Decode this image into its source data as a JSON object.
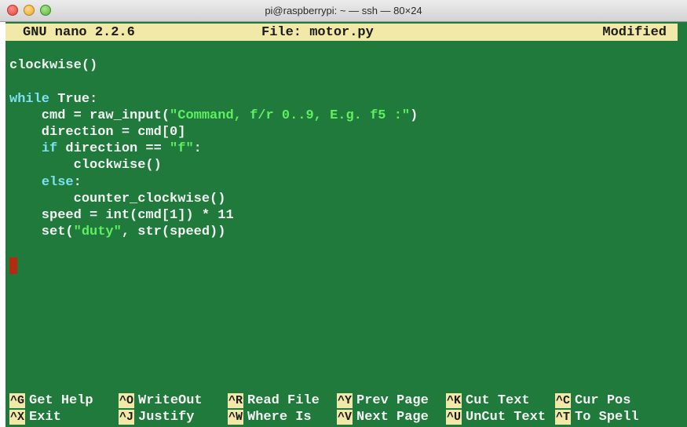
{
  "window": {
    "title": "pi@raspberrypi: ~ — ssh — 80×24"
  },
  "nano": {
    "version": "GNU nano 2.2.6",
    "file": "File: motor.py",
    "state": "Modified"
  },
  "code": {
    "l1": "clockwise()",
    "l3_kw": "while",
    "l3_rest": " True:",
    "l4_a": "    cmd = raw_input(",
    "l4_str": "\"Command, f/r 0..9, E.g. f5 :\"",
    "l4_b": ")",
    "l5": "    direction = cmd[0]",
    "l6_kw": "if",
    "l6_a": " direction == ",
    "l6_str": "\"f\"",
    "l6_b": ":",
    "l7": "        clockwise()",
    "l8_kw": "else",
    "l8_b": ":",
    "l9": "        counter_clockwise()",
    "l10": "    speed = int(cmd[1]) * 11",
    "l11_a": "    set(",
    "l11_str": "\"duty\"",
    "l11_b": ", str(speed))"
  },
  "shortcuts": [
    {
      "key": "^G",
      "label": "Get Help"
    },
    {
      "key": "^O",
      "label": "WriteOut"
    },
    {
      "key": "^R",
      "label": "Read File"
    },
    {
      "key": "^Y",
      "label": "Prev Page"
    },
    {
      "key": "^K",
      "label": "Cut Text"
    },
    {
      "key": "^C",
      "label": "Cur Pos"
    },
    {
      "key": "^X",
      "label": "Exit"
    },
    {
      "key": "^J",
      "label": "Justify"
    },
    {
      "key": "^W",
      "label": "Where Is"
    },
    {
      "key": "^V",
      "label": "Next Page"
    },
    {
      "key": "^U",
      "label": "UnCut Text"
    },
    {
      "key": "^T",
      "label": "To Spell"
    }
  ],
  "colors": {
    "terminal_bg": "#1f7a3c",
    "header_bg": "#f2e8a8",
    "keyword": "#7ee0f0",
    "string": "#5fef5f",
    "cursor": "#b22b10"
  }
}
